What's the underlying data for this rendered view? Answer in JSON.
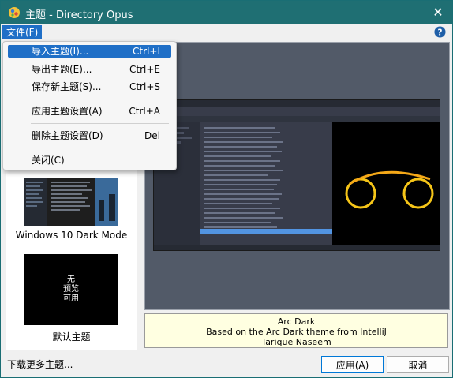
{
  "window": {
    "title": "主题 - Directory Opus"
  },
  "menubar": {
    "file_label": "文件(F)"
  },
  "dropdown": {
    "items": [
      {
        "label": "导入主题(I)...",
        "accel": "Ctrl+I"
      },
      {
        "label": "导出主题(E)...",
        "accel": "Ctrl+E"
      },
      {
        "label": "保存新主题(S)...",
        "accel": "Ctrl+S"
      },
      {
        "label": "应用主题设置(A)",
        "accel": "Ctrl+A"
      },
      {
        "label": "删除主题设置(D)",
        "accel": "Del"
      },
      {
        "label": "关闭(C)",
        "accel": ""
      }
    ]
  },
  "themes": [
    {
      "label": "Windows 10 Dark Mode"
    },
    {
      "label": "默认主题",
      "thumb_lines": [
        "无",
        "预览",
        "可用"
      ]
    }
  ],
  "info": {
    "name": "Arc Dark",
    "description": "Based on the Arc Dark theme from IntelliJ",
    "author": "Tarique Naseem"
  },
  "footer": {
    "download_link": "下载更多主题...",
    "apply_label": "应用(A)",
    "cancel_label": "取消"
  }
}
